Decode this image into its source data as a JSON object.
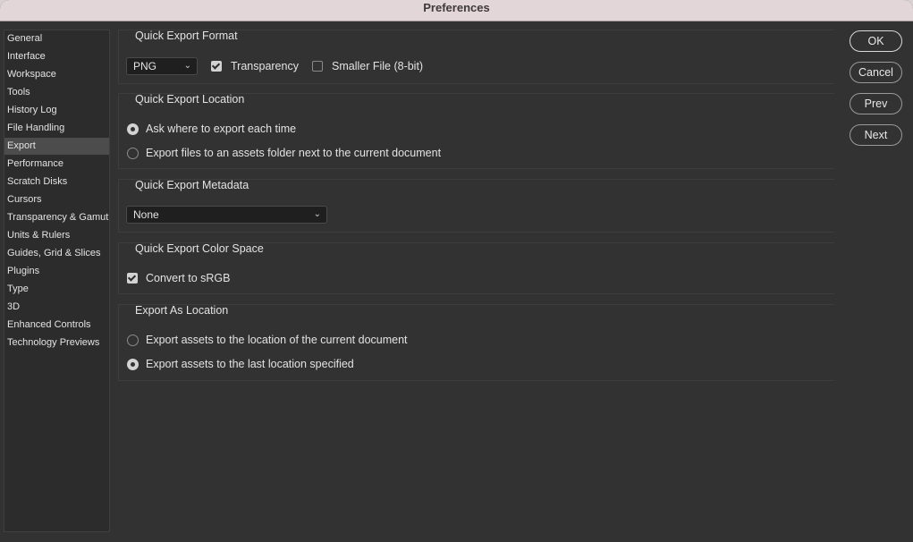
{
  "window": {
    "title": "Preferences"
  },
  "sidebar": {
    "items": [
      {
        "label": "General"
      },
      {
        "label": "Interface"
      },
      {
        "label": "Workspace"
      },
      {
        "label": "Tools"
      },
      {
        "label": "History Log"
      },
      {
        "label": "File Handling"
      },
      {
        "label": "Export",
        "selected": true
      },
      {
        "label": "Performance"
      },
      {
        "label": "Scratch Disks"
      },
      {
        "label": "Cursors"
      },
      {
        "label": "Transparency & Gamut"
      },
      {
        "label": "Units & Rulers"
      },
      {
        "label": "Guides, Grid & Slices"
      },
      {
        "label": "Plugins"
      },
      {
        "label": "Type"
      },
      {
        "label": "3D"
      },
      {
        "label": "Enhanced Controls"
      },
      {
        "label": "Technology Previews"
      }
    ]
  },
  "quick_export_format": {
    "title": "Quick Export Format",
    "format_value": "PNG",
    "transparency_label": "Transparency",
    "transparency_checked": true,
    "smaller_file_label": "Smaller File (8-bit)",
    "smaller_file_checked": false
  },
  "quick_export_location": {
    "title": "Quick Export Location",
    "option_ask": "Ask where to export each time",
    "option_assets_folder": "Export files to an assets folder next to the current document",
    "selected": "ask"
  },
  "quick_export_metadata": {
    "title": "Quick Export Metadata",
    "value": "None"
  },
  "quick_export_color_space": {
    "title": "Quick Export Color Space",
    "convert_label": "Convert to sRGB",
    "convert_checked": true
  },
  "export_as_location": {
    "title": "Export As Location",
    "option_current_doc": "Export assets to the location of the current document",
    "option_last_location": "Export assets to the last location specified",
    "selected": "last"
  },
  "buttons": {
    "ok": "OK",
    "cancel": "Cancel",
    "prev": "Prev",
    "next": "Next"
  },
  "icons": {
    "dropdown": "chevron-down-icon"
  }
}
